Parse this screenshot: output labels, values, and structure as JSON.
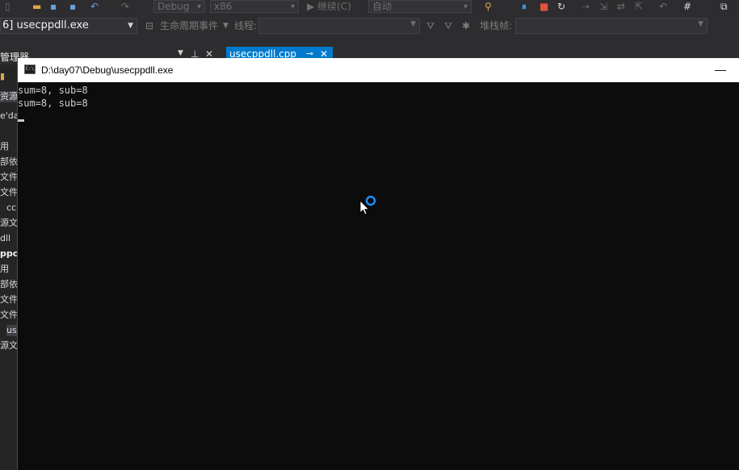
{
  "vs": {
    "toolbar1": {
      "config": "Debug",
      "platform": "x86",
      "continue_label": "▶ 继续(C)",
      "auto": "自动"
    },
    "toolbar2": {
      "process": "6] usecppdll.exe",
      "lifecycle": "生命周期事件",
      "thread_label": "线程:",
      "stackframe_label": "堆栈帧:"
    },
    "panel": {
      "header": "管理器",
      "tab_label": "usecppdll.cpp",
      "tab_pin": "⊸",
      "tab_close": "✕"
    },
    "sidebar_items": [
      "资源",
      "e'da",
      "用",
      "部依",
      "文件",
      "文件",
      "cc",
      "源文",
      "dll",
      "ppc",
      "用",
      "部依",
      "文件",
      "文件",
      "us",
      "源文"
    ]
  },
  "console": {
    "title": "D:\\day07\\Debug\\usecppdll.exe",
    "icon_text": "C:\\",
    "minimize": "—",
    "output_lines": [
      "sum=8, sub=8",
      "sum=8, sub=8"
    ]
  },
  "colors": {
    "accent": "#007acc",
    "console_bg": "#0c0c0c",
    "busy_ring": "#1e90ff"
  }
}
